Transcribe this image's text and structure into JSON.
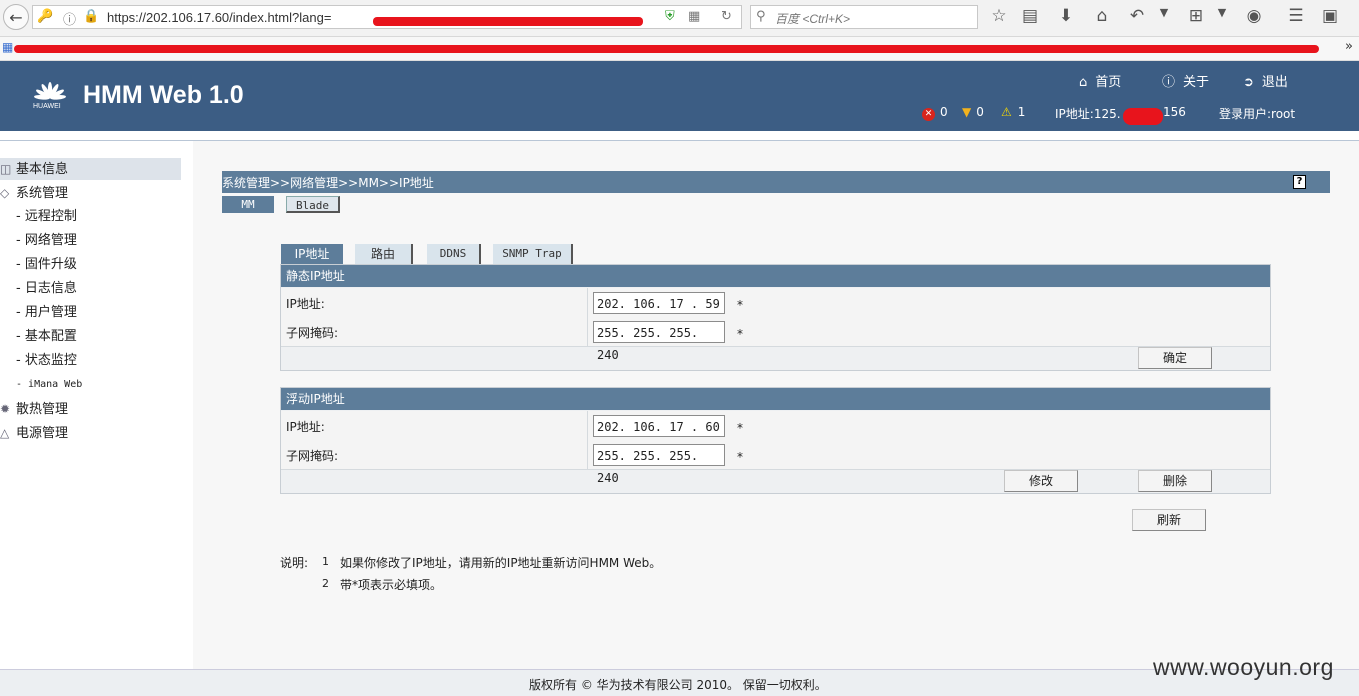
{
  "browser": {
    "url": "https://202.106.17.60/index.html?lang=",
    "search_placeholder": "百度 <Ctrl+K>",
    "overflow": "»"
  },
  "header": {
    "title": "HMM Web 1.0",
    "logo_text": "HUAWEI",
    "links": {
      "home": "首页",
      "about": "关于",
      "logout": "退出"
    },
    "status": {
      "errors": "0",
      "warnings": "0",
      "alerts": "1"
    },
    "ip_prefix": "IP地址:125.",
    "ip_suffix": "156",
    "user": "登录用户:root"
  },
  "sidebar": {
    "basic_info": "基本信息",
    "system_mgmt": "系统管理",
    "sub_items": [
      "远程控制",
      "网络管理",
      "固件升级",
      "日志信息",
      "用户管理",
      "基本配置",
      "状态监控",
      "iMana Web"
    ],
    "cooling": "散热管理",
    "power": "电源管理"
  },
  "breadcrumb": "系统管理>>网络管理>>MM>>IP地址",
  "help": "?",
  "subtabs": {
    "mm": "MM",
    "blade": "Blade"
  },
  "tabs": {
    "ip": "IP地址",
    "route": "路由",
    "ddns": "DDNS",
    "snmp": "SNMP Trap"
  },
  "static_ip": {
    "title": "静态IP地址",
    "ip_label": "IP地址:",
    "ip_value": "202. 106.  17 .  59",
    "mask_label": "子网掩码:",
    "mask_value": "255. 255. 255. 240",
    "required": "*",
    "confirm_button": "确定"
  },
  "float_ip": {
    "title": "浮动IP地址",
    "ip_label": "IP地址:",
    "ip_value": "202. 106.  17 .  60",
    "mask_label": "子网掩码:",
    "mask_value": "255. 255. 255. 240",
    "required": "*",
    "modify_button": "修改",
    "delete_button": "删除"
  },
  "refresh_button": "刷新",
  "notes": {
    "label": "说明:",
    "n1": "1",
    "text1": "如果你修改了IP地址，请用新的IP地址重新访问HMM Web。",
    "n2": "2",
    "text2": "带*项表示必填项。"
  },
  "footer": "版权所有 © 华为技术有限公司 2010。 保留一切权利。",
  "watermark": "www.wooyun.org"
}
